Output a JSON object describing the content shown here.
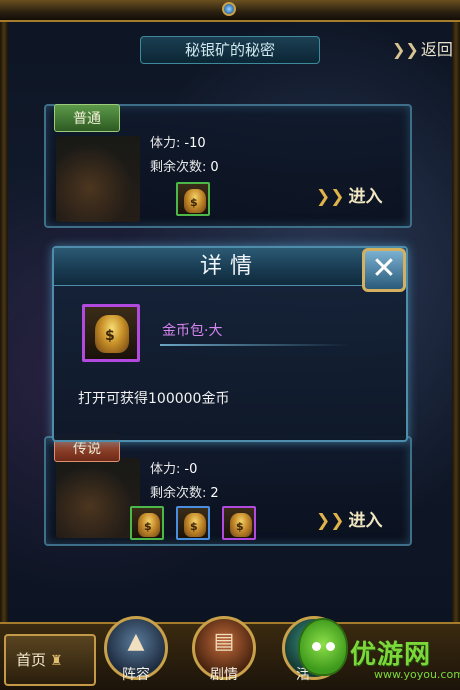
{
  "header": {
    "title": "秘银矿的秘密",
    "back_label": "返回"
  },
  "panels": {
    "normal": {
      "tag": "普通",
      "stamina_label": "体力:",
      "stamina_value": "-10",
      "remaining_label": "剩余次数:",
      "remaining_value": "0",
      "enter_label": "进入",
      "rewards": [
        {
          "icon": "gold-bag-icon",
          "rarity": "green"
        }
      ]
    },
    "legend": {
      "tag": "传说",
      "stamina_label": "体力:",
      "stamina_value": "-0",
      "remaining_label": "剩余次数:",
      "remaining_value": "2",
      "enter_label": "进入",
      "rewards": [
        {
          "icon": "gold-bag-icon",
          "rarity": "green"
        },
        {
          "icon": "gold-bag-icon",
          "rarity": "blue"
        },
        {
          "icon": "gold-bag-icon",
          "rarity": "purple"
        }
      ]
    }
  },
  "modal": {
    "title": "详情",
    "close_icon": "✕",
    "item_name": "金币包·大",
    "item_desc": "打开可获得100000金币",
    "item_rarity_color": "#b24ae0"
  },
  "bottom_nav": {
    "home_label": "首页",
    "items": [
      {
        "label": "阵容",
        "icon": "lineup-icon"
      },
      {
        "label": "剧情",
        "icon": "story-book-icon"
      },
      {
        "label": "活",
        "icon": "activity-icon"
      }
    ]
  },
  "watermark": {
    "brand": "优游网",
    "url": "www.yoyou.com"
  },
  "colors": {
    "panel_border": "#3e6f88",
    "modal_border": "#4e8eac",
    "gold_frame": "#c9a14a",
    "rarity_green": "#4db84a",
    "rarity_blue": "#4a8ee0",
    "rarity_purple": "#b24ae0"
  }
}
